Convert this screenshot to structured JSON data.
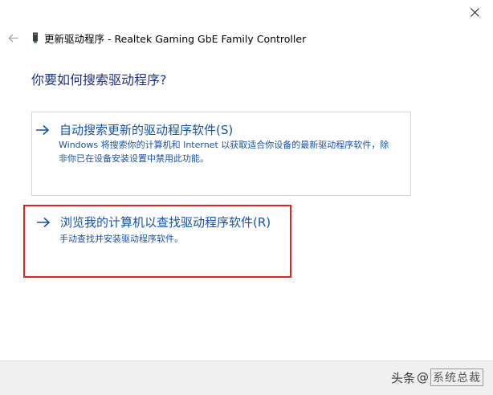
{
  "window": {
    "title": "更新驱动程序 - Realtek Gaming GbE Family Controller"
  },
  "icons": {
    "close": "close-icon",
    "back": "back-arrow-icon",
    "device": "network-adapter-icon",
    "option_arrow": "right-arrow-icon"
  },
  "question": "你要如何搜索驱动程序?",
  "options": {
    "auto": {
      "title": "自动搜索更新的驱动程序软件(S)",
      "description": "Windows 将搜索你的计算机和 Internet 以获取适合你设备的最新驱动程序软件，除非你已在设备安装设置中禁用此功能。"
    },
    "browse": {
      "title": "浏览我的计算机以查找驱动程序软件(R)",
      "description": "手动查找并安装驱动程序软件。"
    }
  },
  "watermark": {
    "author": "头条",
    "at": "@",
    "site": "系统总裁"
  },
  "colors": {
    "question_text": "#1e3287",
    "link_text": "#1753a4",
    "option_border": "#c2dcf2",
    "highlight_border": "#d9281e",
    "footer_bg": "#f0f0f0"
  }
}
